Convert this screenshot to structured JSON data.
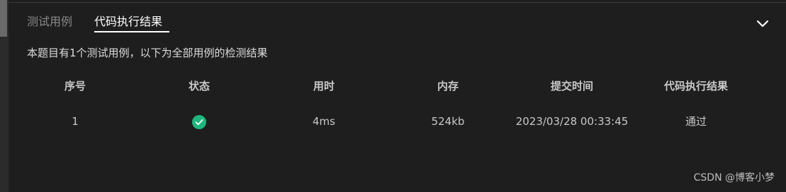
{
  "tabs": {
    "test_cases": "测试用例",
    "result": "代码执行结果"
  },
  "summary": "本题目有1个测试用例，以下为全部用例的检测结果",
  "table": {
    "headers": [
      "序号",
      "状态",
      "用时",
      "内存",
      "提交时间",
      "代码执行结果"
    ],
    "rows": [
      {
        "index": "1",
        "status_icon": "check-circle-icon",
        "time": "4ms",
        "memory": "524kb",
        "submitted_at": "2023/03/28 00:33:45",
        "result": "通过"
      }
    ]
  },
  "watermark": "CSDN @博客小梦",
  "colors": {
    "background": "#1e1e1e",
    "success": "#1db77e",
    "active_tab": "#ffffff",
    "inactive_tab": "#8a8a8a"
  }
}
